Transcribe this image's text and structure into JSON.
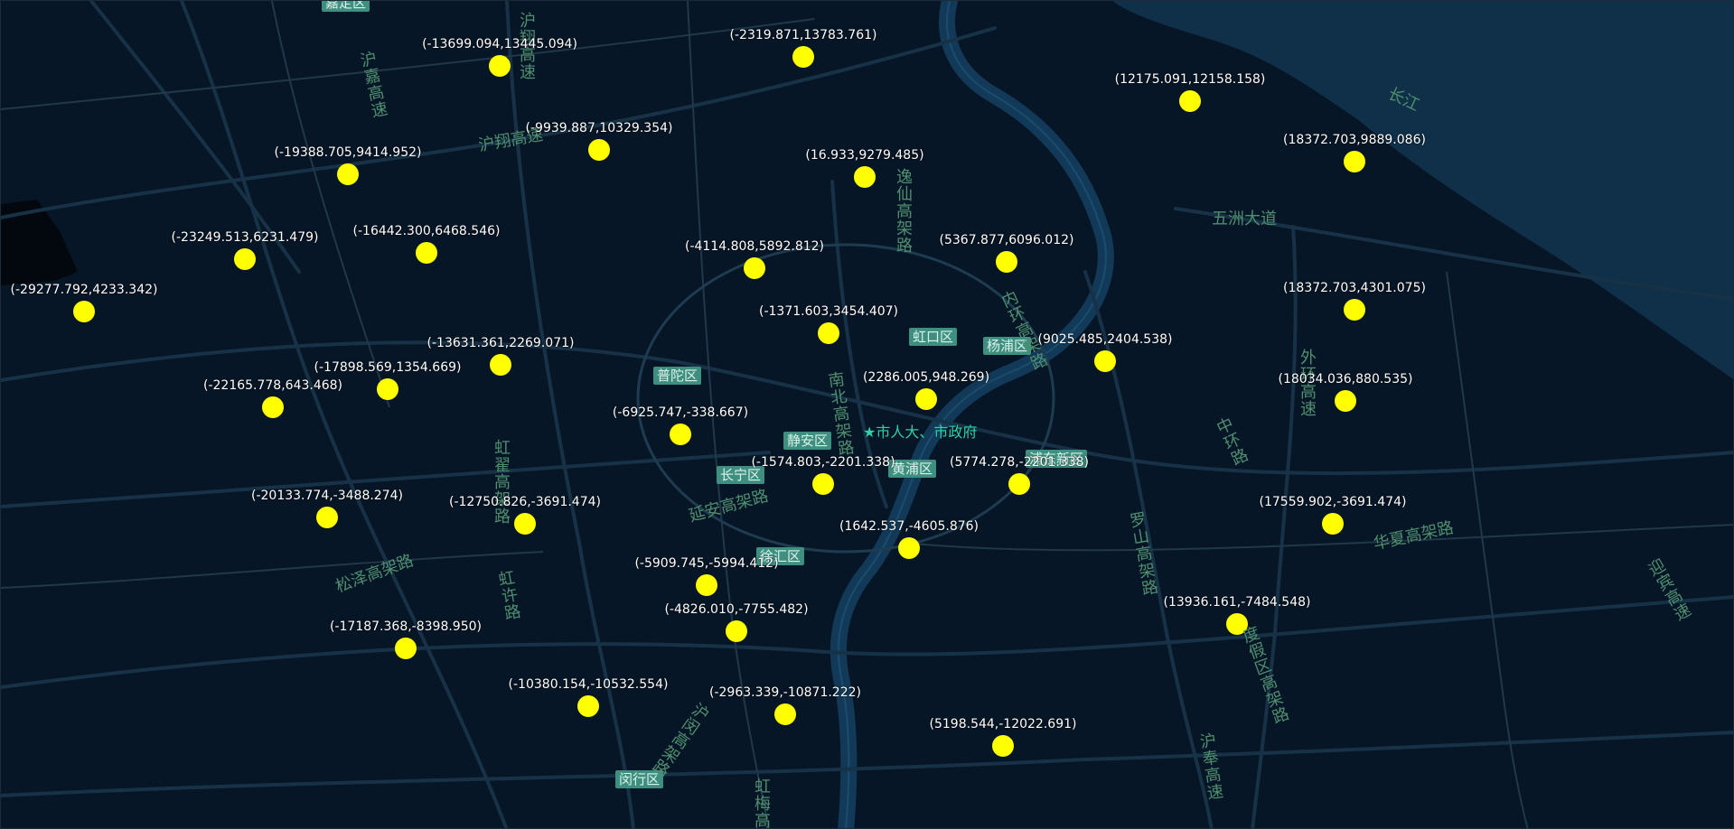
{
  "map": {
    "colors": {
      "water": "#0f3048",
      "river": "#123a58",
      "road": "#173246",
      "boundary": "#243a4c",
      "point": "#ffff00",
      "district_bg": "#3f8f80"
    },
    "points": [
      {
        "label": "(-13699.094,13445.094)"
      },
      {
        "label": "(-2319.871,13783.761)"
      },
      {
        "label": "(12175.091,12158.158)"
      },
      {
        "label": "(-9939.887,10329.354)"
      },
      {
        "label": "(-19388.705,9414.952)"
      },
      {
        "label": "(16.933,9279.485)"
      },
      {
        "label": "(18372.703,9889.086)"
      },
      {
        "label": "(-23249.513,6231.479)"
      },
      {
        "label": "(-16442.300,6468.546)"
      },
      {
        "label": "(-4114.808,5892.812)"
      },
      {
        "label": "(5367.877,6096.012)"
      },
      {
        "label": "(-29277.792,4233.342)"
      },
      {
        "label": "(18372.703,4301.075)"
      },
      {
        "label": "(-1371.603,3454.407)"
      },
      {
        "label": "(9025.485,2404.538)"
      },
      {
        "label": "(-13631.361,2269.071)"
      },
      {
        "label": "(-17898.569,1354.669)"
      },
      {
        "label": "(2286.005,948.269)"
      },
      {
        "label": "(18034.036,880.535)"
      },
      {
        "label": "(-22165.778,643.468)"
      },
      {
        "label": "(-6925.747,-338.667)"
      },
      {
        "label": "(-1574.803,-2201.338)"
      },
      {
        "label": "(5774.278,-2201.338)"
      },
      {
        "label": "(-20133.774,-3488.274)"
      },
      {
        "label": "(-12750.826,-3691.474)"
      },
      {
        "label": "(17559.902,-3691.474)"
      },
      {
        "label": "(1642.537,-4605.876)"
      },
      {
        "label": "(-5909.745,-5994.412)"
      },
      {
        "label": "(-4826.010,-7755.482)"
      },
      {
        "label": "(13936.161,-7484.548)"
      },
      {
        "label": "(-17187.368,-8398.950)"
      },
      {
        "label": "(-10380.154,-10532.554)"
      },
      {
        "label": "(-2963.339,-10871.222)"
      },
      {
        "label": "(5198.544,-12022.691)"
      }
    ],
    "districts": [
      "普陀区",
      "虹口区",
      "杨浦区",
      "静安区",
      "长宁区",
      "黄浦区",
      "徐汇区",
      "闵行区",
      "浦东新区",
      "嘉定区"
    ],
    "roads": [
      "长江",
      "五洲大道",
      "沪翔高速",
      "沪嘉高速",
      "逸仙高架路",
      "内环高架路",
      "南北高架路",
      "延安高架路",
      "虹翟高架路",
      "虹梅高架路",
      "松泽高架路",
      "沪闵高架路",
      "外环高速",
      "中环路",
      "罗山高架路",
      "华夏高架路",
      "迎宾高速",
      "沪奉高速",
      "度假区高架路",
      "虹许路",
      "沪翔高速"
    ],
    "poi": {
      "icon": "star-icon",
      "label": "市人大、市政府"
    }
  }
}
